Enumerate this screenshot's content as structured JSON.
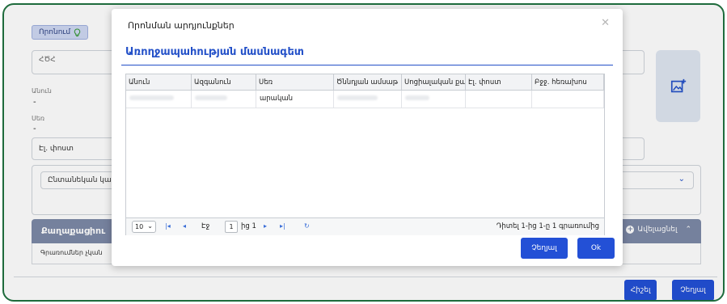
{
  "background": {
    "search_label": "Որոնում",
    "name_field_placeholder": "ՀԾՀ",
    "label_name": "Անուն",
    "value_name": "-",
    "label_gender": "Սեռ",
    "value_gender": "-",
    "email_placeholder": "Էլ. փոստ",
    "general_select": "Ընտանեկան կա",
    "section_title": "Քաղաքացիու",
    "add_label": "Ավելացնել",
    "records_text": "Գրառումներ չկան",
    "remember_button": "Հիշել",
    "cancel_button": "Չեղյալ"
  },
  "modal": {
    "title": "Որոնման արդյունքներ",
    "subtitle": "Առողջապահության մասնագետ",
    "columns": [
      "Անուն",
      "Ազգանուն",
      "Սեռ",
      "Ծննդյան ամսաթ",
      "Սոցիալական քա",
      "Էլ. փոստ",
      "Բջջ. հեռախոս"
    ],
    "rows": [
      {
        "gender": "արական"
      }
    ],
    "pager": {
      "page_size": "10",
      "page_label": "Էջ",
      "page_value": "1",
      "of_label": "ից 1",
      "summary": "Դիտել 1-ից 1-ը 1 գրառումից"
    },
    "cancel_button": "Չեղյալ",
    "ok_button": "Ok"
  },
  "colors": {
    "primary": "#2350d6",
    "frame": "#1e6b3c",
    "section_bar": "#7d8aa7"
  }
}
